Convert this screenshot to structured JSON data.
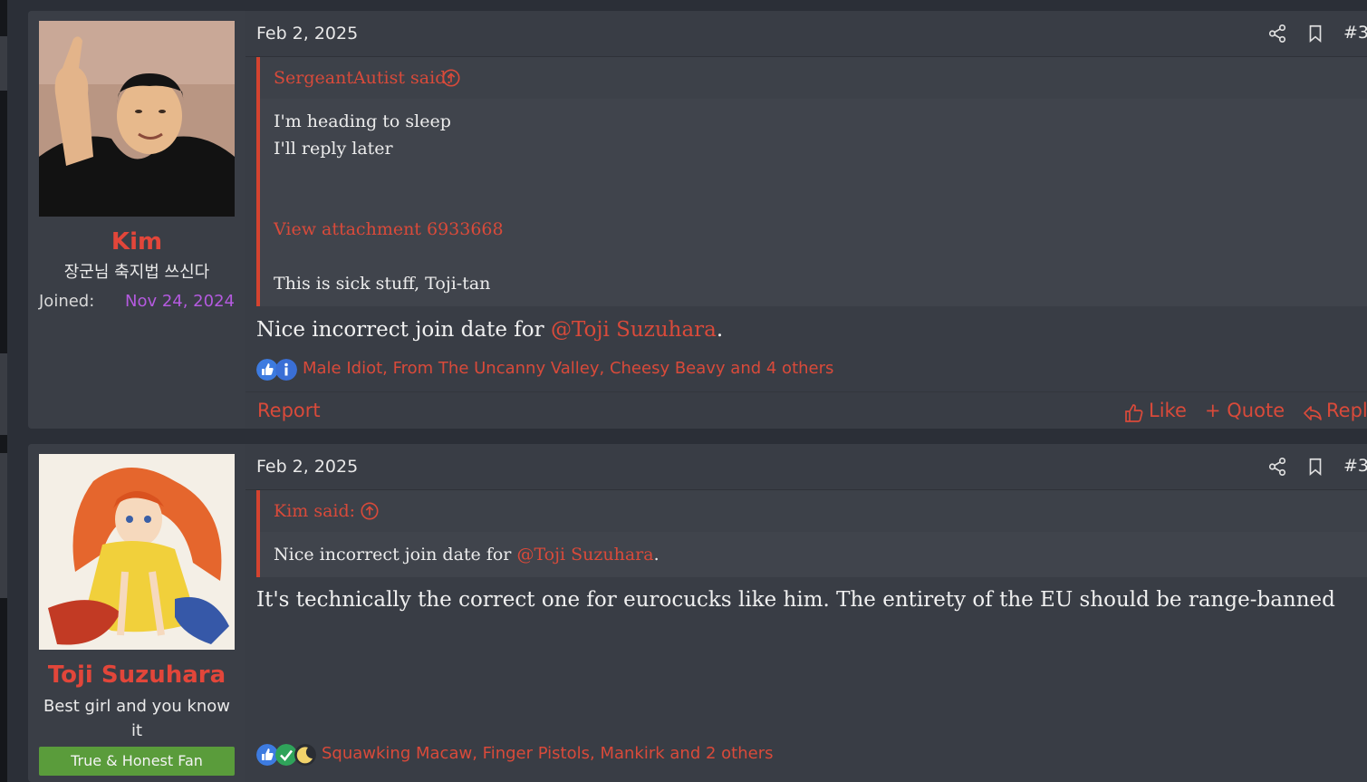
{
  "posts": [
    {
      "author": {
        "name": "Kim",
        "title": "장군님 축지법 쓰신다",
        "joined_label": "Joined:",
        "joined_date": "Nov 24, 2024"
      },
      "date": "Feb 2, 2025",
      "post_number": "#3",
      "quote": {
        "attribution": "SergeantAutist said:",
        "lines": [
          "I'm heading to sleep",
          "I'll reply later"
        ],
        "attachment": "View attachment 6933668",
        "closing": "This is sick stuff, Toji-tan"
      },
      "body": {
        "before": "Nice incorrect join date for ",
        "mention": "@Toji Suzuhara",
        "after": "."
      },
      "reactions": {
        "icons": [
          "like-icon",
          "informative-icon"
        ],
        "names": "Male Idiot, From The Uncanny Valley, Cheesy Beavy and 4 others"
      },
      "footer": {
        "report": "Report",
        "like": "Like",
        "quote": "+ Quote",
        "reply": "Reply"
      }
    },
    {
      "author": {
        "name": "Toji Suzuhara",
        "title": "Best girl and you know it",
        "banner": "True & Honest Fan"
      },
      "date": "Feb 2, 2025",
      "post_number": "#3",
      "quote": {
        "attribution": "Kim said:",
        "before": "Nice incorrect join date for ",
        "mention": "@Toji Suzuhara",
        "after": "."
      },
      "body": "It's technically the correct one for eurocucks like him. The entirety of the EU should be range-banned",
      "reactions": {
        "icons": [
          "like-icon",
          "agree-icon",
          "moon-icon"
        ],
        "names": "Squawking Macaw, Finger Pistols, Mankirk and 2 others"
      }
    }
  ],
  "colors": {
    "accent": "#d94a3a",
    "joined_date": "#b45adf",
    "banner": "#5a9c3b",
    "background": "#2b2f37"
  }
}
